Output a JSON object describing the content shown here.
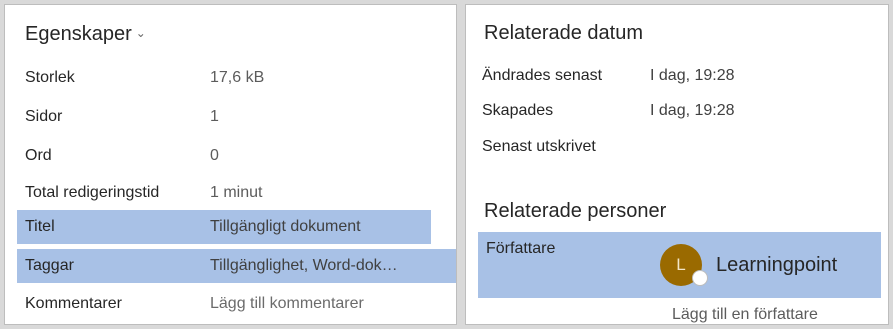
{
  "properties": {
    "heading": "Egenskaper",
    "heading_caret": "⌄",
    "rows": [
      {
        "label": "Storlek",
        "value": "17,6 kB"
      },
      {
        "label": "Sidor",
        "value": "1"
      },
      {
        "label": "Ord",
        "value": "0"
      },
      {
        "label": "Total redigeringstid",
        "value": "1 minut"
      },
      {
        "label": "Titel",
        "value": "Tillgängligt dokument"
      },
      {
        "label": "Taggar",
        "value": "Tillgänglighet, Word-dok…"
      },
      {
        "label": "Kommentarer",
        "value": "Lägg till kommentarer"
      }
    ]
  },
  "related_dates": {
    "heading": "Relaterade datum",
    "rows": [
      {
        "label": "Ändrades senast",
        "value": "I dag, 19:28"
      },
      {
        "label": "Skapades",
        "value": "I dag, 19:28"
      },
      {
        "label": "Senast utskrivet",
        "value": ""
      }
    ]
  },
  "related_people": {
    "heading": "Relaterade personer",
    "author_label": "Författare",
    "author_initial": "L",
    "author_name": "Learningpoint",
    "add_author": "Lägg till en författare"
  },
  "colors": {
    "highlight": "#a8c1e6",
    "avatar": "#9a6a00"
  }
}
